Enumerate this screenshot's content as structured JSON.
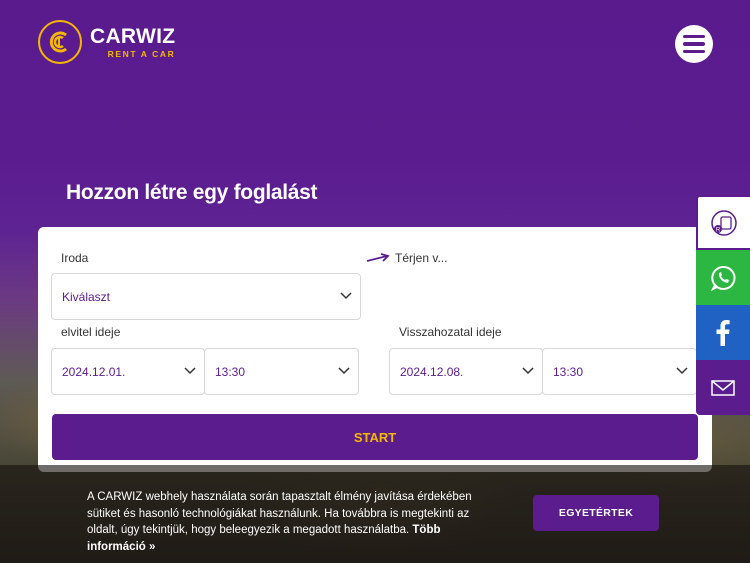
{
  "header": {
    "brand_name": "CARWIZ",
    "brand_tagline": "RENT A CAR"
  },
  "booking": {
    "title": "Hozzon létre egy foglalást",
    "office_label": "Iroda",
    "office_value": "Kiválaszt",
    "return_link": "Térjen v...",
    "pickup_label": "elvitel ideje",
    "pickup_date": "2024.12.01.",
    "pickup_time": "13:30",
    "return_label": "Visszahozatal ideje",
    "return_date": "2024.12.08.",
    "return_time": "13:30",
    "start_button": "START"
  },
  "cookie": {
    "text": "A CARWIZ webhely használata során tapasztalt élmény javítása érdekében sütiket és hasonló technológiákat használunk. Ha továbbra is megtekinti az oldalt, úgy tekintjük, hogy beleegyezik a megadott használatba.",
    "more_link": "Több információ »",
    "accept_button": "EGYETÉRTEK"
  },
  "colors": {
    "primary": "#5b1c8e",
    "accent": "#f5b800",
    "whatsapp": "#2bb741",
    "facebook": "#1f62c4"
  },
  "side_icons": [
    "rent-icon",
    "whatsapp-icon",
    "facebook-icon",
    "mail-icon"
  ]
}
